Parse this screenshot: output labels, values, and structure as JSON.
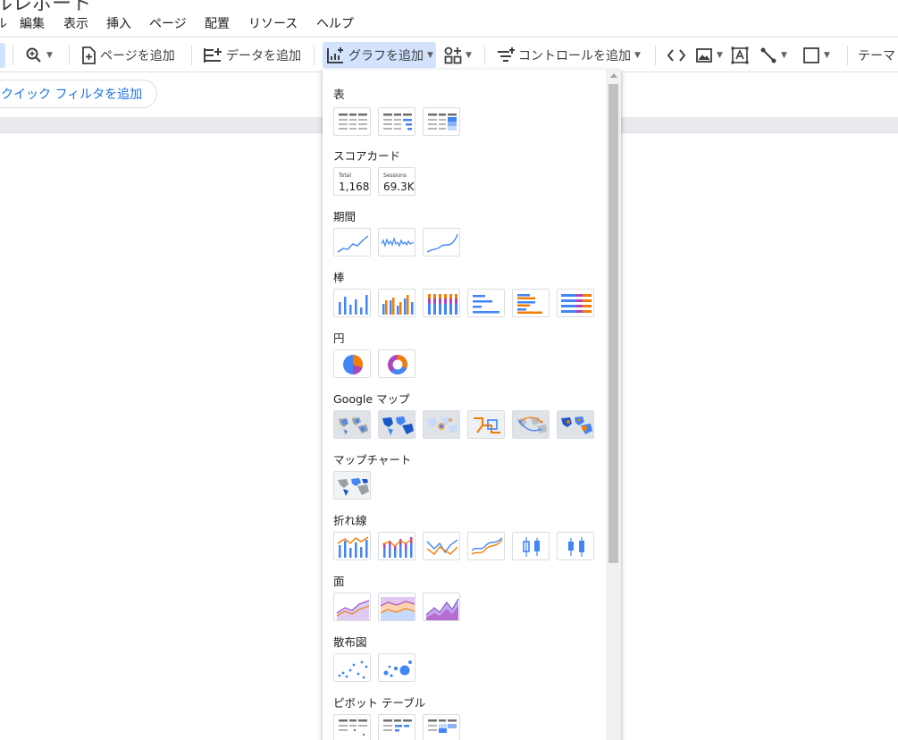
{
  "title": "ルレポート",
  "menu": [
    {
      "label": "ル"
    },
    {
      "label": "編集"
    },
    {
      "label": "表示"
    },
    {
      "label": "挿入"
    },
    {
      "label": "ページ"
    },
    {
      "label": "配置"
    },
    {
      "label": "リソース"
    },
    {
      "label": "ヘルプ"
    }
  ],
  "toolbar": {
    "add_page": "ページを追加",
    "add_data": "データを追加",
    "add_chart": "グラフを追加",
    "add_control": "コントロールを追加",
    "theme": "テーマ"
  },
  "filter": {
    "label": "クイック フィルタを追加"
  },
  "panel": {
    "sections": {
      "table": "表",
      "scorecard": "スコアカード",
      "timeseries": "期間",
      "bar": "棒",
      "pie": "円",
      "geo": "Google マップ",
      "mapchart": "マップチャート",
      "line": "折れ線",
      "area": "面",
      "scatter": "散布図",
      "pivot": "ピボット テーブル"
    },
    "scorecards": [
      {
        "label": "Total",
        "value": "1,168"
      },
      {
        "label": "Sessions",
        "value": "69.3K"
      }
    ]
  },
  "colors": {
    "blue": "#4285f4",
    "orange": "#f57c00",
    "purple": "#ab47bc",
    "accent": "#1a73e8",
    "active_bg": "#d3e3fd"
  }
}
